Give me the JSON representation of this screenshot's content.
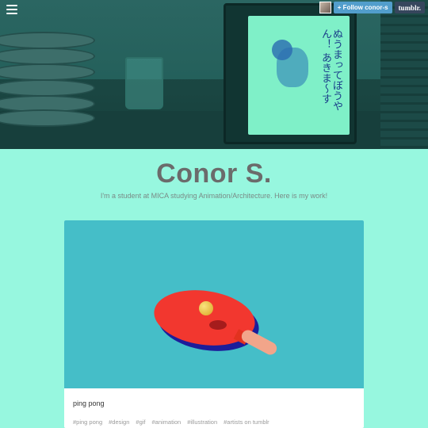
{
  "header": {
    "screen_script": "ぬうまってぼうやん！ あきま〜す"
  },
  "nav": {
    "follow_label": "+ Follow conor-s",
    "brand_label": "tumblr."
  },
  "blog": {
    "title": "Conor S.",
    "description": "I'm a student at MICA studying Animation/Architecture. Here is my work!"
  },
  "post": {
    "caption": "ping pong",
    "tags": [
      "#ping pong",
      "#design",
      "#gif",
      "#animation",
      "#illustration",
      "#artists on tumblr"
    ]
  },
  "colors": {
    "background": "#97f7df",
    "post_image_bg": "#45bec8",
    "follow_button": "#529ecc",
    "tumblr_button": "#36465d",
    "paddle": "#f2372f"
  },
  "icons": [
    "menu-icon",
    "avatar"
  ]
}
